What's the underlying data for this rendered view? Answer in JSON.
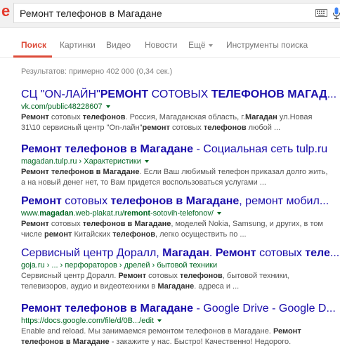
{
  "search": {
    "logo_fragment": "e",
    "query": "Ремонт телефонов в Магадане"
  },
  "tabs": [
    {
      "label": "Поиск",
      "active": true
    },
    {
      "label": "Картинки"
    },
    {
      "label": "Видео"
    },
    {
      "label": "Новости"
    },
    {
      "label": "Ещё"
    },
    {
      "label": "Инструменты поиска"
    }
  ],
  "stats": "Результатов: примерно 402 000 (0,34 сек.)",
  "results": [
    {
      "title_parts": [
        {
          "t": "СЦ \"ON-ЛАЙН\"",
          "b": false
        },
        {
          "t": "РЕМОНТ",
          "b": true
        },
        {
          "t": " СОТОВЫХ ",
          "b": false
        },
        {
          "t": "ТЕЛЕФОНОВ МАГАД",
          "b": true
        },
        {
          "t": "...",
          "b": false
        }
      ],
      "url": "vk.com/public48228607",
      "snippet_parts": [
        {
          "t": "Ремонт",
          "b": true
        },
        {
          "t": " сотовых ",
          "b": false
        },
        {
          "t": "телефонов",
          "b": true
        },
        {
          "t": ". Россия, Магаданская область, г.",
          "b": false
        },
        {
          "t": "Магадан",
          "b": true
        },
        {
          "t": " ул.Новая 31\\10 сервисный центр \"On-лайн\"",
          "b": false
        },
        {
          "t": "ремонт",
          "b": true
        },
        {
          "t": " сотовых ",
          "b": false
        },
        {
          "t": "телефонов",
          "b": true
        },
        {
          "t": " любой ...",
          "b": false
        }
      ]
    },
    {
      "title_parts": [
        {
          "t": "Ремонт телефонов в Магадане",
          "b": true
        },
        {
          "t": " - Социальная сеть tulp.ru",
          "b": false
        }
      ],
      "url": "magadan.tulp.ru › Характеристики",
      "snippet_parts": [
        {
          "t": "Ремонт телефонов в Магадане",
          "b": true
        },
        {
          "t": ". Если Ваш любимый телефон приказал долго жить, а на новый денег нет, то Вам придется воспользоваться услугами ...",
          "b": false
        }
      ]
    },
    {
      "title_parts": [
        {
          "t": "Ремонт",
          "b": true
        },
        {
          "t": " сотовых ",
          "b": false
        },
        {
          "t": "телефонов в Магадане",
          "b": true
        },
        {
          "t": ", ремонт мобил...",
          "b": false
        }
      ],
      "url_parts": [
        {
          "t": "www.",
          "b": false
        },
        {
          "t": "magadan",
          "b": true
        },
        {
          "t": ".web-plakat.ru/",
          "b": false
        },
        {
          "t": "remont",
          "b": true
        },
        {
          "t": "-sotovih-telefonov/",
          "b": false
        }
      ],
      "snippet_parts": [
        {
          "t": "Ремонт",
          "b": true
        },
        {
          "t": " сотовых ",
          "b": false
        },
        {
          "t": "телефонов в Магадане",
          "b": true
        },
        {
          "t": ", моделей Nokia, Samsung, и других, в том числе ",
          "b": false
        },
        {
          "t": "ремонт",
          "b": true
        },
        {
          "t": " Китайских ",
          "b": false
        },
        {
          "t": "телефонов",
          "b": true
        },
        {
          "t": ", легко осуществить по ...",
          "b": false
        }
      ]
    },
    {
      "title_parts": [
        {
          "t": "Сервисный центр Доралл, ",
          "b": false
        },
        {
          "t": "Магадан",
          "b": true
        },
        {
          "t": ". ",
          "b": false
        },
        {
          "t": "Ремонт",
          "b": true
        },
        {
          "t": " сотовых ",
          "b": false
        },
        {
          "t": "теле",
          "b": true
        },
        {
          "t": "...",
          "b": false
        }
      ],
      "url": "goja.ru › ... › перфораторов › дрелей › бытовой техники",
      "snippet_parts": [
        {
          "t": "Сервисный центр Доралл. ",
          "b": false
        },
        {
          "t": "Ремонт",
          "b": true
        },
        {
          "t": " сотовых ",
          "b": false
        },
        {
          "t": "телефонов",
          "b": true
        },
        {
          "t": ", бытовой техники, телевизоров, аудио и видеотехники в ",
          "b": false
        },
        {
          "t": "Магадане",
          "b": true
        },
        {
          "t": ". адреса и ...",
          "b": false
        }
      ]
    },
    {
      "title_parts": [
        {
          "t": "Ремонт телефонов в Магадане",
          "b": true
        },
        {
          "t": " - Google Drive - Google D...",
          "b": false
        }
      ],
      "url": "https://docs.google.com/file/d/0B.../edit",
      "snippet_parts": [
        {
          "t": "Enable and reload. Мы занимаемся ремонтом телефонов в Магадане. ",
          "b": false
        },
        {
          "t": "Ремонт телефонов в Магадане",
          "b": true
        },
        {
          "t": " - закажите у нас. Быстро! Качественно! Недорого.",
          "b": false
        }
      ]
    }
  ]
}
